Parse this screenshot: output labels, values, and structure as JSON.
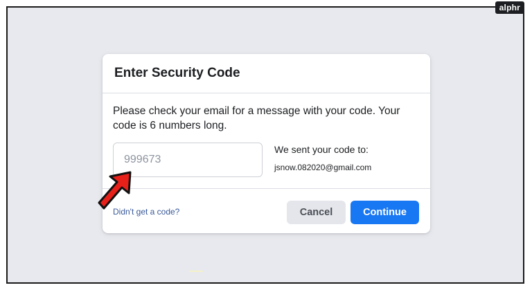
{
  "watermark": "alphr",
  "dialog": {
    "title": "Enter Security Code",
    "message": "Please check your email for a message with your code. Your code is 6 numbers long.",
    "code_input": {
      "placeholder": "999673",
      "value": ""
    },
    "sent_label": "We sent your code to:",
    "sent_email": "jsnow.082020@gmail.com",
    "resend_link": "Didn't get a code?",
    "cancel_label": "Cancel",
    "continue_label": "Continue"
  },
  "annotation": {
    "icon": "red-arrow-icon",
    "color": "#e8201a"
  },
  "colors": {
    "primary": "#1877f2",
    "link": "#385898",
    "backdrop": "#e8e9ee"
  }
}
